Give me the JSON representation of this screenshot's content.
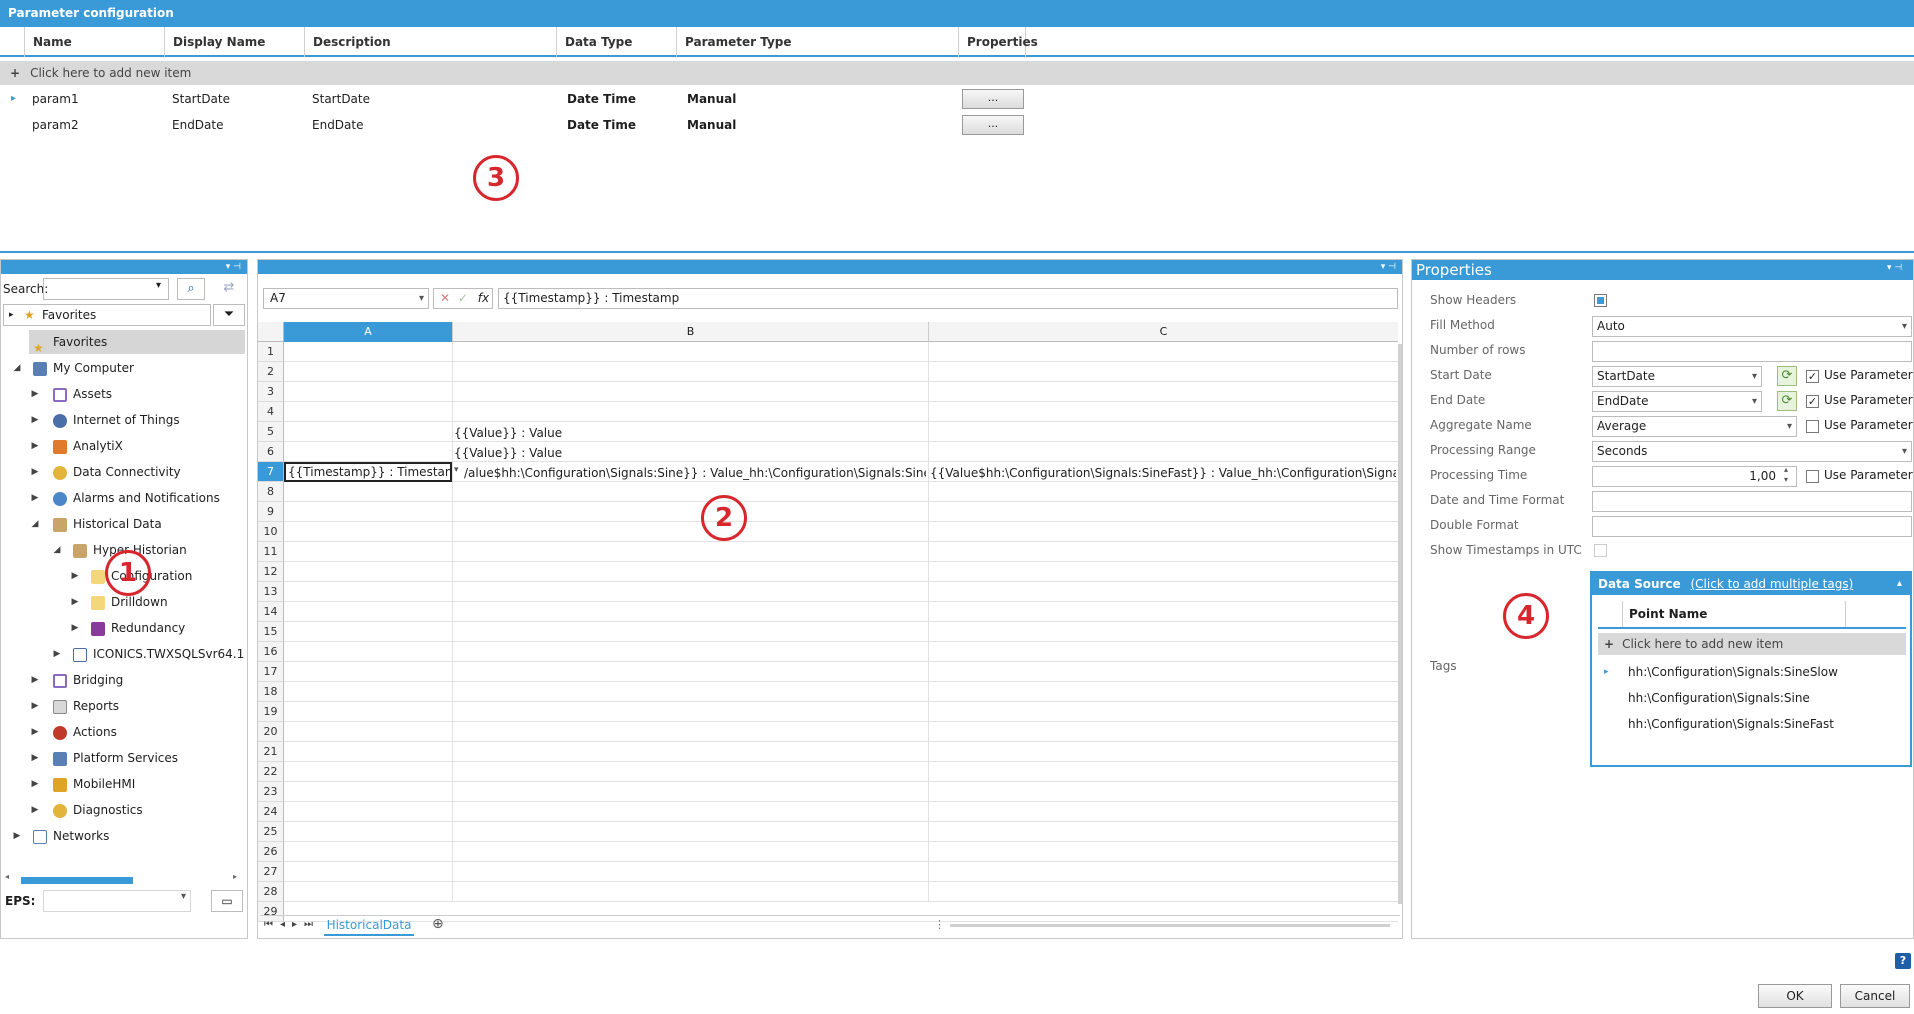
{
  "param_config": {
    "title": "Parameter configuration",
    "columns": [
      "Name",
      "Display Name",
      "Description",
      "Data Type",
      "Parameter Type",
      "Properties"
    ],
    "add_row": "Click here to add new item",
    "rows": [
      {
        "name": "param1",
        "display": "StartDate",
        "description": "StartDate",
        "data_type": "Date Time",
        "param_type": "Manual",
        "props": "..."
      },
      {
        "name": "param2",
        "display": "EndDate",
        "description": "EndDate",
        "data_type": "Date Time",
        "param_type": "Manual",
        "props": "..."
      }
    ]
  },
  "callouts": [
    "1",
    "2",
    "3",
    "4"
  ],
  "tree": {
    "search_label": "Search:",
    "favorites_filter": "Favorites",
    "items": [
      {
        "label": "Favorites",
        "icon": "star-icon"
      },
      {
        "label": "My Computer",
        "icon": "computer-icon"
      },
      {
        "label": "Assets",
        "icon": "assets-icon"
      },
      {
        "label": "Internet of Things",
        "icon": "iot-icon"
      },
      {
        "label": "AnalytiX",
        "icon": "analytix-icon"
      },
      {
        "label": "Data Connectivity",
        "icon": "data-connectivity-icon"
      },
      {
        "label": "Alarms and Notifications",
        "icon": "alarm-icon"
      },
      {
        "label": "Historical Data",
        "icon": "historical-data-icon"
      },
      {
        "label": "Hyper Historian",
        "icon": "historian-icon"
      },
      {
        "label": "Configuration",
        "icon": "folder-icon"
      },
      {
        "label": "Drilldown",
        "icon": "folder-icon"
      },
      {
        "label": "Redundancy",
        "icon": "cube-icon"
      },
      {
        "label": "ICONICS.TWXSQLSvr64.1",
        "icon": "server-icon"
      },
      {
        "label": "Bridging",
        "icon": "bridging-icon"
      },
      {
        "label": "Reports",
        "icon": "reports-icon"
      },
      {
        "label": "Actions",
        "icon": "actions-icon"
      },
      {
        "label": "Platform Services",
        "icon": "platform-icon"
      },
      {
        "label": "MobileHMI",
        "icon": "mobile-icon"
      },
      {
        "label": "Diagnostics",
        "icon": "diagnostics-icon"
      },
      {
        "label": "Networks",
        "icon": "networks-icon"
      }
    ],
    "eps_label": "EPS:"
  },
  "sheet": {
    "name_box": "A7",
    "fx": "fx",
    "formula": "{{Timestamp}} : Timestamp",
    "columns": [
      "A",
      "B",
      "C"
    ],
    "rows": [
      "1",
      "2",
      "3",
      "4",
      "5",
      "6",
      "7",
      "8",
      "9",
      "10",
      "11",
      "12",
      "13",
      "14",
      "15",
      "16",
      "17",
      "18",
      "19",
      "20",
      "21",
      "22",
      "23",
      "24",
      "25",
      "26",
      "27",
      "28",
      "29"
    ],
    "cell_b5": "{{Value}} : Value",
    "cell_b6": "{{Value}} : Value",
    "cell_a7": "{{Timestamp}} : Timestamp",
    "cell_b7": "/alue$hh:\\Configuration\\Signals:Sine}} : Value_hh:\\Configuration\\Signals:Sine",
    "cell_c7": "{{Value$hh:\\Configuration\\Signals:SineFast}} : Value_hh:\\Configuration\\Signal",
    "tab": "HistoricalData"
  },
  "properties": {
    "title": "Properties",
    "show_headers": "Show Headers",
    "fill_method": "Fill Method",
    "fill_method_value": "Auto",
    "number_of_rows": "Number of rows",
    "start_date": "Start Date",
    "start_date_value": "StartDate",
    "end_date": "End Date",
    "end_date_value": "EndDate",
    "aggregate_name": "Aggregate Name",
    "aggregate_value": "Average",
    "processing_range": "Processing Range",
    "processing_range_value": "Seconds",
    "processing_time": "Processing Time",
    "processing_time_value": "1,00",
    "date_time_format": "Date and Time Format",
    "double_format": "Double Format",
    "show_utc": "Show Timestamps in UTC",
    "tags": "Tags",
    "use_parameter": "Use Parameter",
    "data_source": "Data Source",
    "data_source_link": "(Click to add multiple tags)",
    "point_name": "Point Name",
    "add_item": "Click here to add new item",
    "points": [
      "hh:\\Configuration\\Signals:SineSlow",
      "hh:\\Configuration\\Signals:Sine",
      "hh:\\Configuration\\Signals:SineFast"
    ]
  },
  "footer": {
    "help": "?",
    "ok": "OK",
    "cancel": "Cancel"
  },
  "colors": {
    "accent": "#3a9ad8",
    "callout": "#d8262d"
  }
}
